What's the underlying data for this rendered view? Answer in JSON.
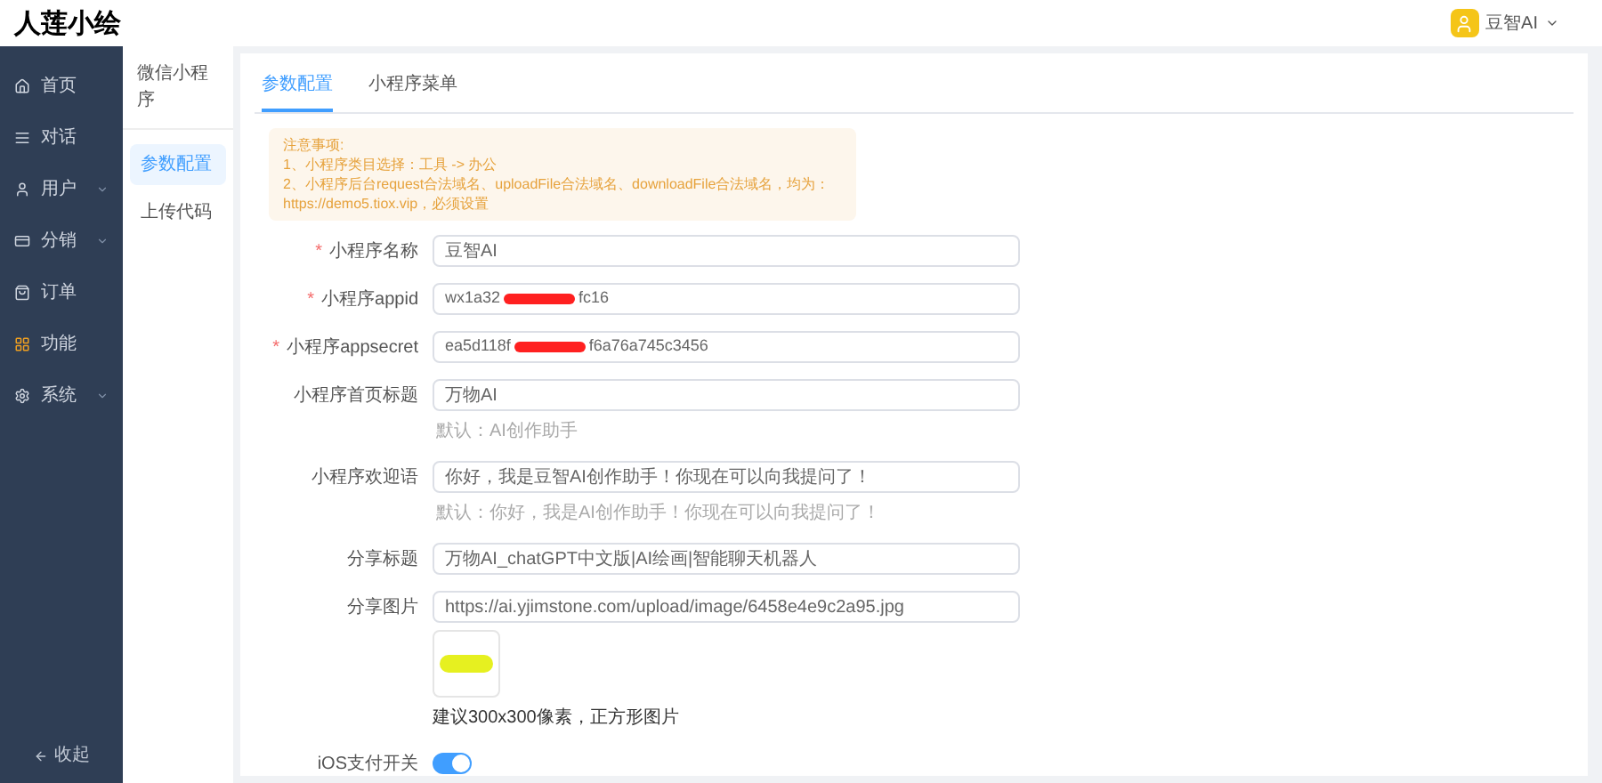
{
  "header": {
    "logo": "人莲小绘",
    "user": "豆智AI"
  },
  "nav": {
    "items": [
      {
        "label": "首页",
        "expandable": false
      },
      {
        "label": "对话",
        "expandable": false
      },
      {
        "label": "用户",
        "expandable": true
      },
      {
        "label": "分销",
        "expandable": true
      },
      {
        "label": "订单",
        "expandable": false
      },
      {
        "label": "功能",
        "expandable": false
      },
      {
        "label": "系统",
        "expandable": true
      }
    ],
    "collapse": "收起"
  },
  "submenu": {
    "title": "微信小程序",
    "items": [
      {
        "label": "参数配置",
        "selected": true
      },
      {
        "label": "上传代码",
        "selected": false
      }
    ]
  },
  "tabs": [
    {
      "label": "参数配置",
      "selected": true
    },
    {
      "label": "小程序菜单",
      "selected": false
    }
  ],
  "notice": {
    "title": "注意事项:",
    "lines": [
      "1、小程序类目选择：工具 -> 办公",
      "2、小程序后台request合法域名、uploadFile合法域名、downloadFile合法域名，均为：https://demo5.tiox.vip，必须设置"
    ]
  },
  "form": {
    "fields": [
      {
        "kind": "input",
        "label": "小程序名称",
        "required_mark": "*",
        "value": "豆智AI"
      },
      {
        "kind": "redacted",
        "label": "小程序appid",
        "required_mark": "*",
        "value_parts": [
          "wx1a32",
          "fc16"
        ]
      },
      {
        "kind": "redacted",
        "label": "小程序appsecret",
        "required_mark": "*",
        "value_parts": [
          "ea5d118f",
          "f6a76a745c3456"
        ]
      },
      {
        "kind": "input",
        "label": "小程序首页标题",
        "value": "万物AI",
        "hint": "默认：AI创作助手"
      },
      {
        "kind": "input",
        "label": "小程序欢迎语",
        "value": "你好，我是豆智AI创作助手！你现在可以向我提问了！",
        "hint": "默认：你好，我是AI创作助手！你现在可以向我提问了！"
      },
      {
        "kind": "input",
        "label": "分享标题",
        "value": "万物AI_chatGPT中文版|AI绘画|智能聊天机器人"
      },
      {
        "kind": "image",
        "label": "分享图片",
        "value": "https://ai.yjimstone.com/upload/image/6458e4e9c2a95.jpg",
        "hint": "建议300x300像素，正方形图片"
      },
      {
        "kind": "switch",
        "label": "iOS支付开关",
        "on": true
      }
    ]
  }
}
